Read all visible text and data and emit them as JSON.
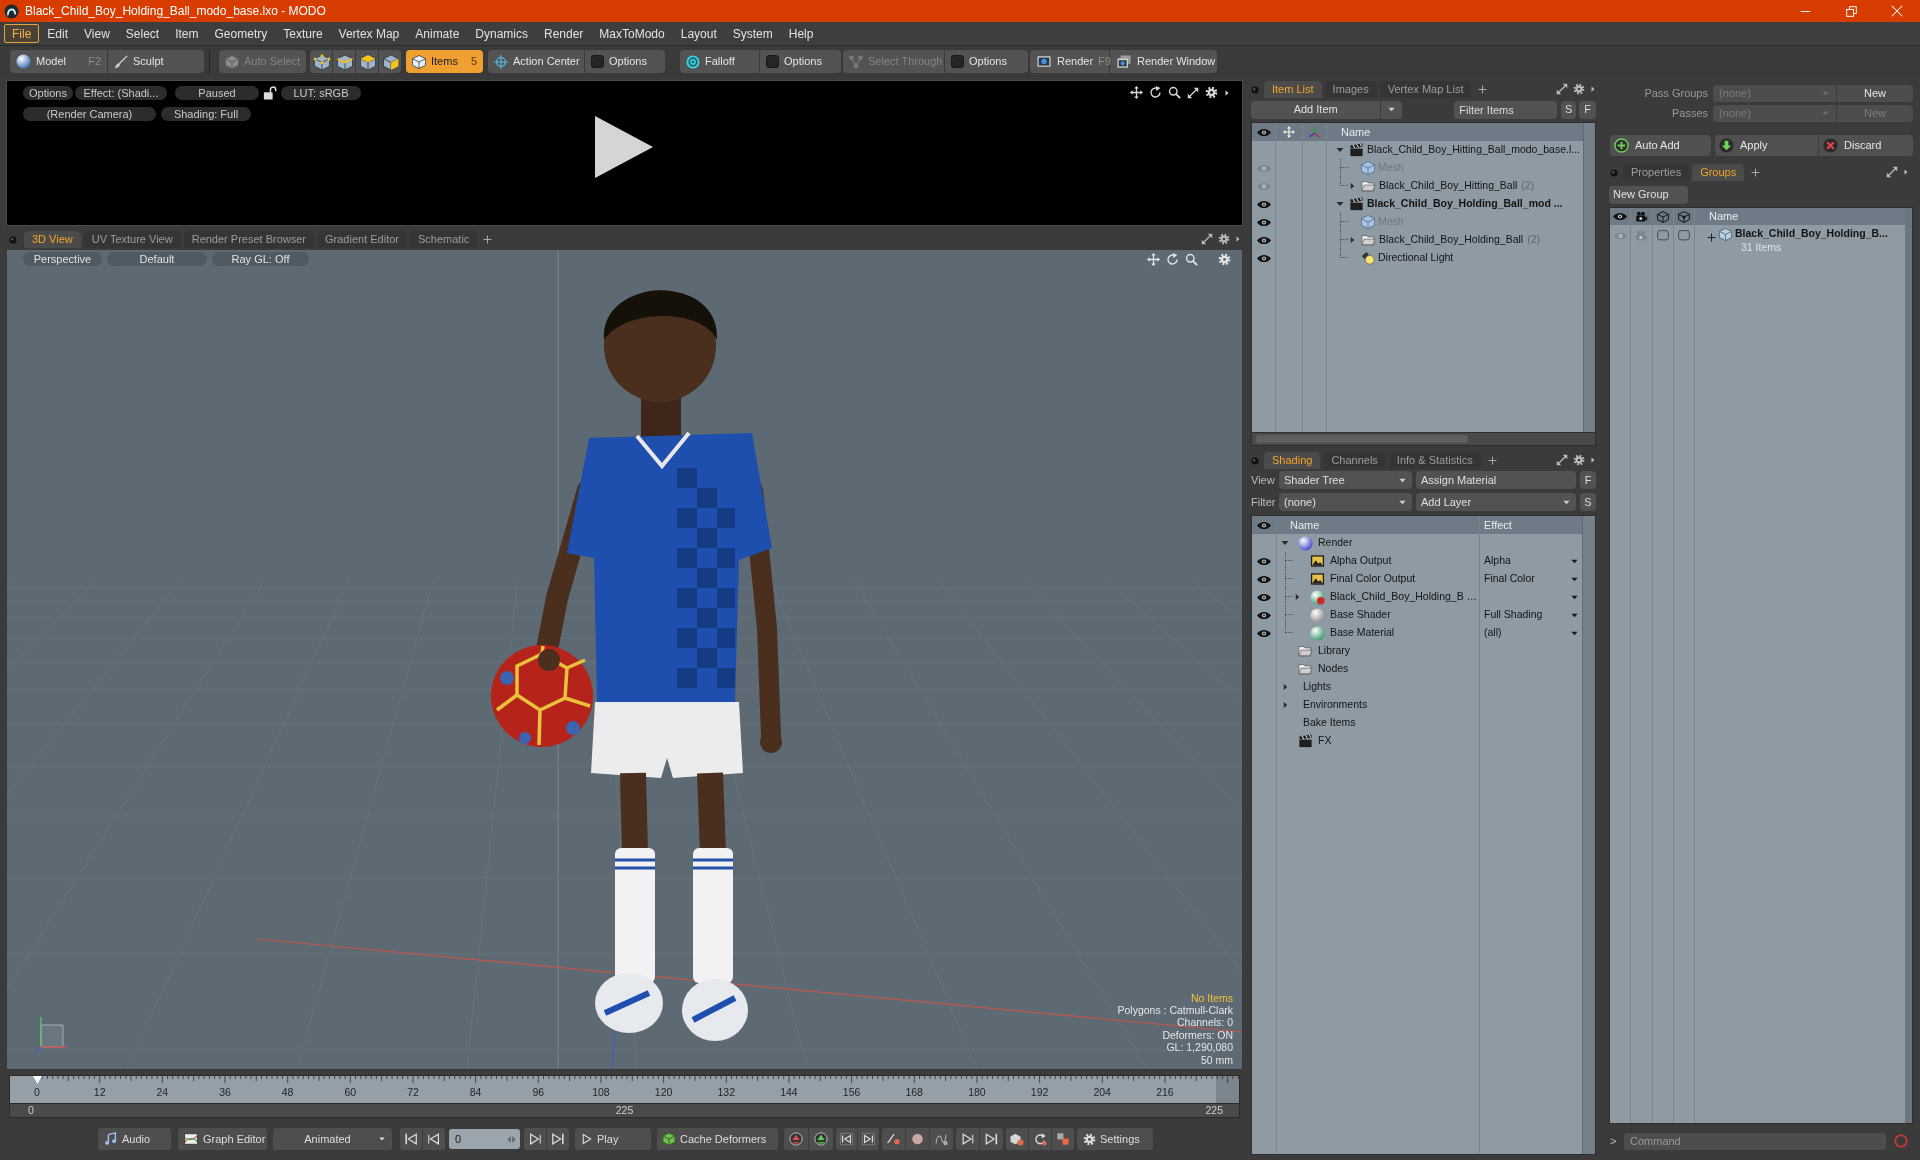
{
  "window": {
    "title": "Black_Child_Boy_Holding_Ball_modo_base.lxo - MODO"
  },
  "menu": [
    {
      "label": "File",
      "selected": true
    },
    {
      "label": "Edit",
      "selected": false
    },
    {
      "label": "View",
      "selected": false
    },
    {
      "label": "Select",
      "selected": false
    },
    {
      "label": "Item",
      "selected": false
    },
    {
      "label": "Geometry",
      "selected": false
    },
    {
      "label": "Texture",
      "selected": false
    },
    {
      "label": "Vertex Map",
      "selected": false
    },
    {
      "label": "Animate",
      "selected": false
    },
    {
      "label": "Dynamics",
      "selected": false
    },
    {
      "label": "Render",
      "selected": false
    },
    {
      "label": "MaxToModo",
      "selected": false
    },
    {
      "label": "Layout",
      "selected": false
    },
    {
      "label": "System",
      "selected": false
    },
    {
      "label": "Help",
      "selected": false
    }
  ],
  "toolbar": {
    "model": {
      "label": "Model",
      "shortcut": "F2"
    },
    "sculpt": {
      "label": "Sculpt"
    },
    "auto_select": {
      "label": "Auto Select",
      "disabled": true
    },
    "select_modes": [
      {
        "selected": false
      },
      {
        "selected": false
      },
      {
        "selected": false
      },
      {
        "selected": false
      },
      {
        "label": "Items",
        "shortcut": "5",
        "selected": true
      }
    ],
    "action_center": {
      "label": "Action Center",
      "disabled": false,
      "options": {
        "label": "Options",
        "checked": false
      }
    },
    "falloff": {
      "label": "Falloff",
      "disabled": false,
      "options": {
        "label": "Options",
        "checked": false
      }
    },
    "select_through": {
      "label": "Select Through",
      "disabled": true,
      "options": {
        "label": "Options",
        "checked": false
      }
    },
    "render": {
      "label": "Render",
      "shortcut": "F9"
    },
    "render_window": {
      "label": "Render Window"
    }
  },
  "preview": {
    "options": "Options",
    "effect": "Effect: (Shadi...",
    "state": "Paused",
    "lut": "LUT: sRGB",
    "camera": "(Render Camera)",
    "shading": "Shading: Full"
  },
  "viewport": {
    "tabs": [
      {
        "label": "3D View",
        "selected": true
      },
      {
        "label": "UV Texture View",
        "selected": false
      },
      {
        "label": "Render Preset Browser",
        "selected": false
      },
      {
        "label": "Gradient Editor",
        "selected": false
      },
      {
        "label": "Schematic",
        "selected": false
      }
    ],
    "view": "Perspective",
    "style": "Default",
    "ray_gl": "Ray GL: Off",
    "info": [
      {
        "text": "No Items",
        "kind": "highlight"
      },
      {
        "text": "Polygons : Catmull-Clark",
        "kind": "plain"
      },
      {
        "text": "Channels: 0",
        "kind": "plain"
      },
      {
        "text": "Deformers: ON",
        "kind": "plain"
      },
      {
        "text": "GL: 1,290,080",
        "kind": "plain"
      },
      {
        "text": "50 mm",
        "kind": "plain"
      }
    ]
  },
  "timeline": {
    "ticks": [
      "0",
      "12",
      "24",
      "36",
      "48",
      "60",
      "72",
      "84",
      "96",
      "108",
      "120",
      "132",
      "144",
      "156",
      "168",
      "180",
      "192",
      "204",
      "216"
    ],
    "range_start": "0",
    "range_mid": "225",
    "range_end": "225"
  },
  "transport": {
    "audio": "Audio",
    "graph_editor": "Graph Editor",
    "mode": "Animated",
    "frame": "0",
    "play": "Play",
    "cache": "Cache Deformers",
    "settings": "Settings"
  },
  "item_list": {
    "tabs": [
      {
        "label": "Item List",
        "selected": true
      },
      {
        "label": "Images",
        "selected": false
      },
      {
        "label": "Vertex Map List",
        "selected": false
      }
    ],
    "add_item": "Add Item",
    "filter_placeholder": "Filter Items",
    "s_button": "S",
    "f_button": "F",
    "name_column": "Name",
    "items": [
      {
        "name": "Black_Child_Boy_Hitting_Ball_modo_base.l...",
        "kind": "scene",
        "visible": false,
        "current": false,
        "dimmed": false,
        "expanded": true,
        "children": [
          {
            "name": "Mesh",
            "kind": "mesh",
            "visible": true,
            "eye_dimmed": true,
            "current": false,
            "dimmed": true
          },
          {
            "name": "Black_Child_Boy_Hitting_Ball",
            "count": "(2)",
            "kind": "group",
            "visible": true,
            "eye_dimmed": true,
            "current": false,
            "dimmed": false,
            "expanded": false
          }
        ]
      },
      {
        "name": "Black_Child_Boy_Holding_Ball_mod ...",
        "kind": "scene",
        "visible": true,
        "eye_dimmed": false,
        "current": true,
        "dimmed": false,
        "expanded": true,
        "children": [
          {
            "name": "Mesh",
            "kind": "mesh",
            "visible": true,
            "eye_dimmed": false,
            "current": false,
            "dimmed": true
          },
          {
            "name": "Black_Child_Boy_Holding_Ball",
            "count": "(2)",
            "kind": "group",
            "visible": true,
            "eye_dimmed": false,
            "current": false,
            "dimmed": false,
            "expanded": false
          },
          {
            "name": "Directional Light",
            "kind": "light",
            "visible": true,
            "eye_dimmed": false,
            "current": false,
            "dimmed": false
          }
        ]
      }
    ]
  },
  "shading": {
    "tabs": [
      {
        "label": "Shading",
        "selected": true
      },
      {
        "label": "Channels",
        "selected": false
      },
      {
        "label": "Info & Statistics",
        "selected": false
      }
    ],
    "view_label": "View",
    "view": "Shader Tree",
    "assign": "Assign Material",
    "f_button": "F",
    "filter_label": "Filter",
    "filter": "(none)",
    "add_layer": "Add Layer",
    "s_button": "S",
    "columns": [
      "Name",
      "Effect"
    ],
    "items": [
      {
        "name": "Render",
        "kind": "render",
        "visible": false,
        "expanded": true,
        "children": [
          {
            "name": "Alpha Output",
            "kind": "output",
            "visible": true,
            "effect": "Alpha"
          },
          {
            "name": "Final Color Output",
            "kind": "output",
            "visible": true,
            "effect": "Final Color"
          },
          {
            "name": "Black_Child_Boy_Holding_B …",
            "kind": "material_group",
            "visible": true,
            "expanded": false
          },
          {
            "name": "Base Shader",
            "kind": "shader",
            "visible": true,
            "effect": "Full Shading"
          },
          {
            "name": "Base Material",
            "kind": "material",
            "visible": true,
            "effect": "(all)"
          }
        ]
      },
      {
        "name": "Library",
        "kind": "folder",
        "visible": false
      },
      {
        "name": "Nodes",
        "kind": "folder",
        "visible": false
      },
      {
        "name": "Lights",
        "kind": "category",
        "visible": false,
        "expanded": false
      },
      {
        "name": "Environments",
        "kind": "category",
        "visible": false,
        "expanded": false
      },
      {
        "name": "Bake Items",
        "kind": "category",
        "visible": false
      },
      {
        "name": "FX",
        "kind": "fx",
        "visible": false
      }
    ]
  },
  "passes": {
    "rows": [
      {
        "label": "Pass Groups",
        "value": "(none)",
        "button": "New",
        "disabled": false
      },
      {
        "label": "Passes",
        "value": "(none)",
        "button": "New",
        "disabled": true
      }
    ],
    "auto_add": "Auto Add",
    "apply": "Apply",
    "discard": "Discard"
  },
  "groups": {
    "tabs": [
      {
        "label": "Properties",
        "selected": false
      },
      {
        "label": "Groups",
        "selected": true
      }
    ],
    "new_group": "New Group",
    "name_column": "Name",
    "items": [
      {
        "name": "Black_Child_Boy_Holding_B...",
        "count": "31 Items",
        "visible": true,
        "expanded": false
      }
    ]
  },
  "command": {
    "prompt": ">",
    "placeholder": "Command"
  }
}
